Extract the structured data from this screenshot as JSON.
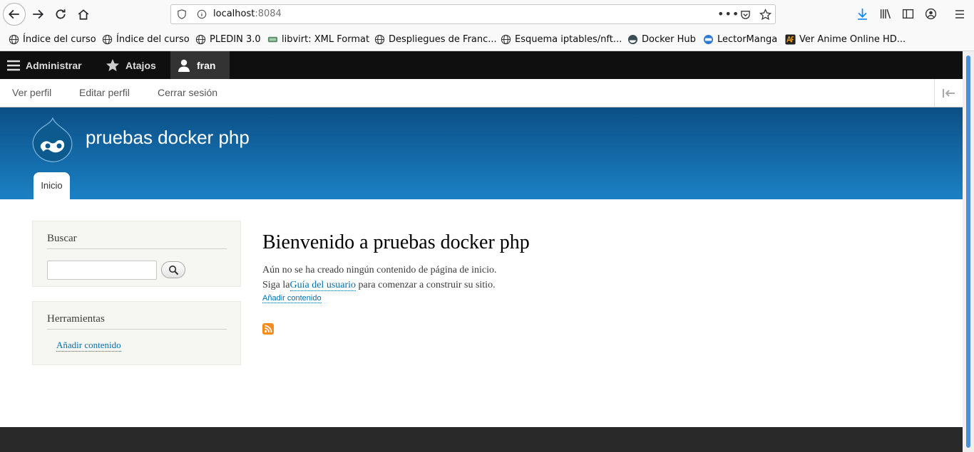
{
  "browser": {
    "url_host": "localhost",
    "url_port": ":8084",
    "bookmarks": [
      {
        "label": "Índice del curso",
        "icon": "globe-icon"
      },
      {
        "label": "Índice del curso",
        "icon": "globe-icon"
      },
      {
        "label": "PLEDIN 3.0",
        "icon": "globe-icon"
      },
      {
        "label": "libvirt: XML Format",
        "icon": "libvirt-icon"
      },
      {
        "label": "Despliegues de Franc...",
        "icon": "globe-icon"
      },
      {
        "label": "Esquema iptables/nft...",
        "icon": "globe-icon"
      },
      {
        "label": "Docker Hub",
        "icon": "docker-icon"
      },
      {
        "label": "LectorManga",
        "icon": "lectormanga-icon"
      },
      {
        "label": "Ver Anime Online HD...",
        "icon": "animeflv-icon"
      }
    ]
  },
  "admin_bar": {
    "manage": "Administrar",
    "shortcuts": "Atajos",
    "user": "fran"
  },
  "tray": {
    "view_profile": "Ver perfil",
    "edit_profile": "Editar perfil",
    "logout": "Cerrar sesión"
  },
  "site": {
    "name": "pruebas docker php",
    "tab_home": "Inicio"
  },
  "sidebar": {
    "search_title": "Buscar",
    "tools_title": "Herramientas",
    "tools_add": "Añadir contenido"
  },
  "main": {
    "title": "Bienvenido a pruebas docker php",
    "line1": "Aún no se ha creado ningún contenido de página de inicio.",
    "line2_prefix": "Siga la",
    "line2_link": "Guía del usuario",
    "line2_suffix": " para comenzar a construir su sitio.",
    "add_content": "Añadir contenido"
  },
  "colors": {
    "header_top": "#0b4f86",
    "header_bottom": "#1b81c4",
    "link": "#0071b3",
    "admin_bar": "#0f0f0f"
  }
}
